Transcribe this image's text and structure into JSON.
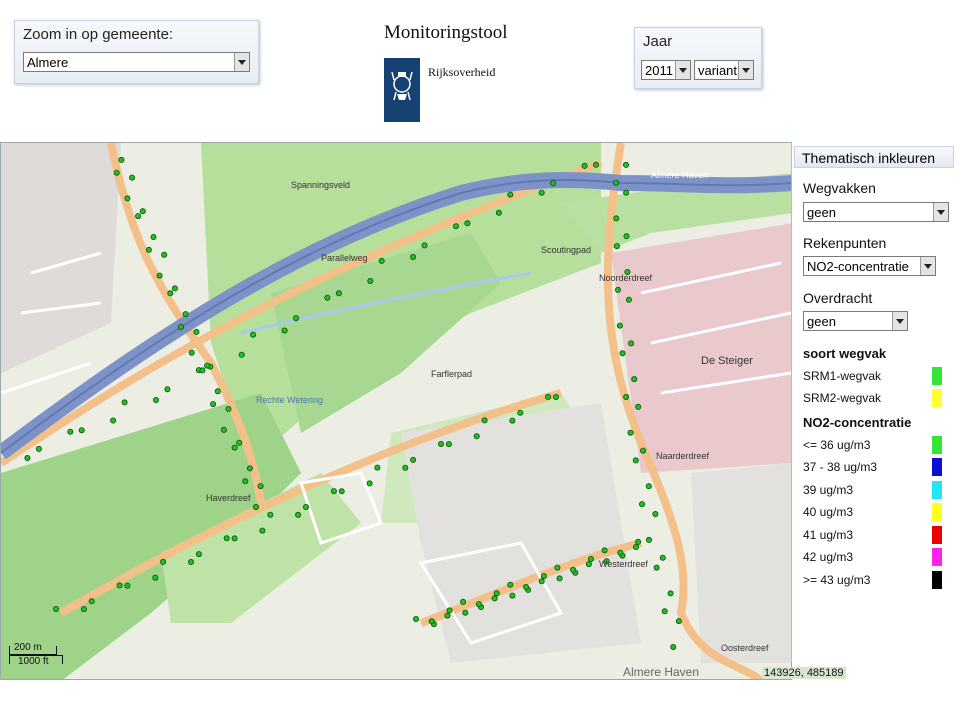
{
  "header": {
    "zoom_panel": {
      "title": "Zoom in op gemeente:",
      "selected": "Almere"
    },
    "logo": {
      "title": "Monitoringstool",
      "org": "Rijksoverheid"
    },
    "year_panel": {
      "title": "Jaar",
      "year": "2011",
      "variant": "variant"
    }
  },
  "map": {
    "labels": {
      "spanningsveld": "Spanningsveld",
      "almere_haven": "Almere Haven",
      "scoutingpad": "Scoutingpad",
      "de_steiger": "De Steiger",
      "rechte_wetering": "Rechte Wetering",
      "farflerpad": "Farflerpad",
      "westerdreef": "Westerdreef",
      "haverdreef": "Haverdreef",
      "parallelweg": "Parallelweg",
      "noorderdreef": "Noorderdreef",
      "naarderdreef": "Naarderdreef",
      "oosterdreef": "Oosterdreef",
      "almere_haven_bottom": "Almere Haven"
    },
    "scale": {
      "metric": "200 m",
      "imperial": "1000 ft"
    },
    "coordinates": "143926, 485189"
  },
  "legend": {
    "title": "Thematisch inkleuren",
    "wegvakken": {
      "label": "Wegvakken",
      "selected": "geen"
    },
    "rekenpunten": {
      "label": "Rekenpunten",
      "selected": "NO2-concentratie"
    },
    "overdracht": {
      "label": "Overdracht",
      "selected": "geen"
    },
    "soort_wegvak": {
      "heading": "soort wegvak",
      "items": [
        {
          "label": "SRM1-wegvak",
          "color": "#33e633"
        },
        {
          "label": "SRM2-wegvak",
          "color": "#ffff33"
        }
      ]
    },
    "no2": {
      "heading": "NO2-concentratie",
      "items": [
        {
          "label": "<= 36 ug/m3",
          "color": "#33e633"
        },
        {
          "label": "37 - 38 ug/m3",
          "color": "#0a10d0"
        },
        {
          "label": "39 ug/m3",
          "color": "#22e5f5"
        },
        {
          "label": "40 ug/m3",
          "color": "#ffff22"
        },
        {
          "label": "41 ug/m3",
          "color": "#ee0000"
        },
        {
          "label": "42 ug/m3",
          "color": "#ff22ee"
        },
        {
          "label": ">= 43 ug/m3",
          "color": "#000000"
        }
      ]
    }
  }
}
